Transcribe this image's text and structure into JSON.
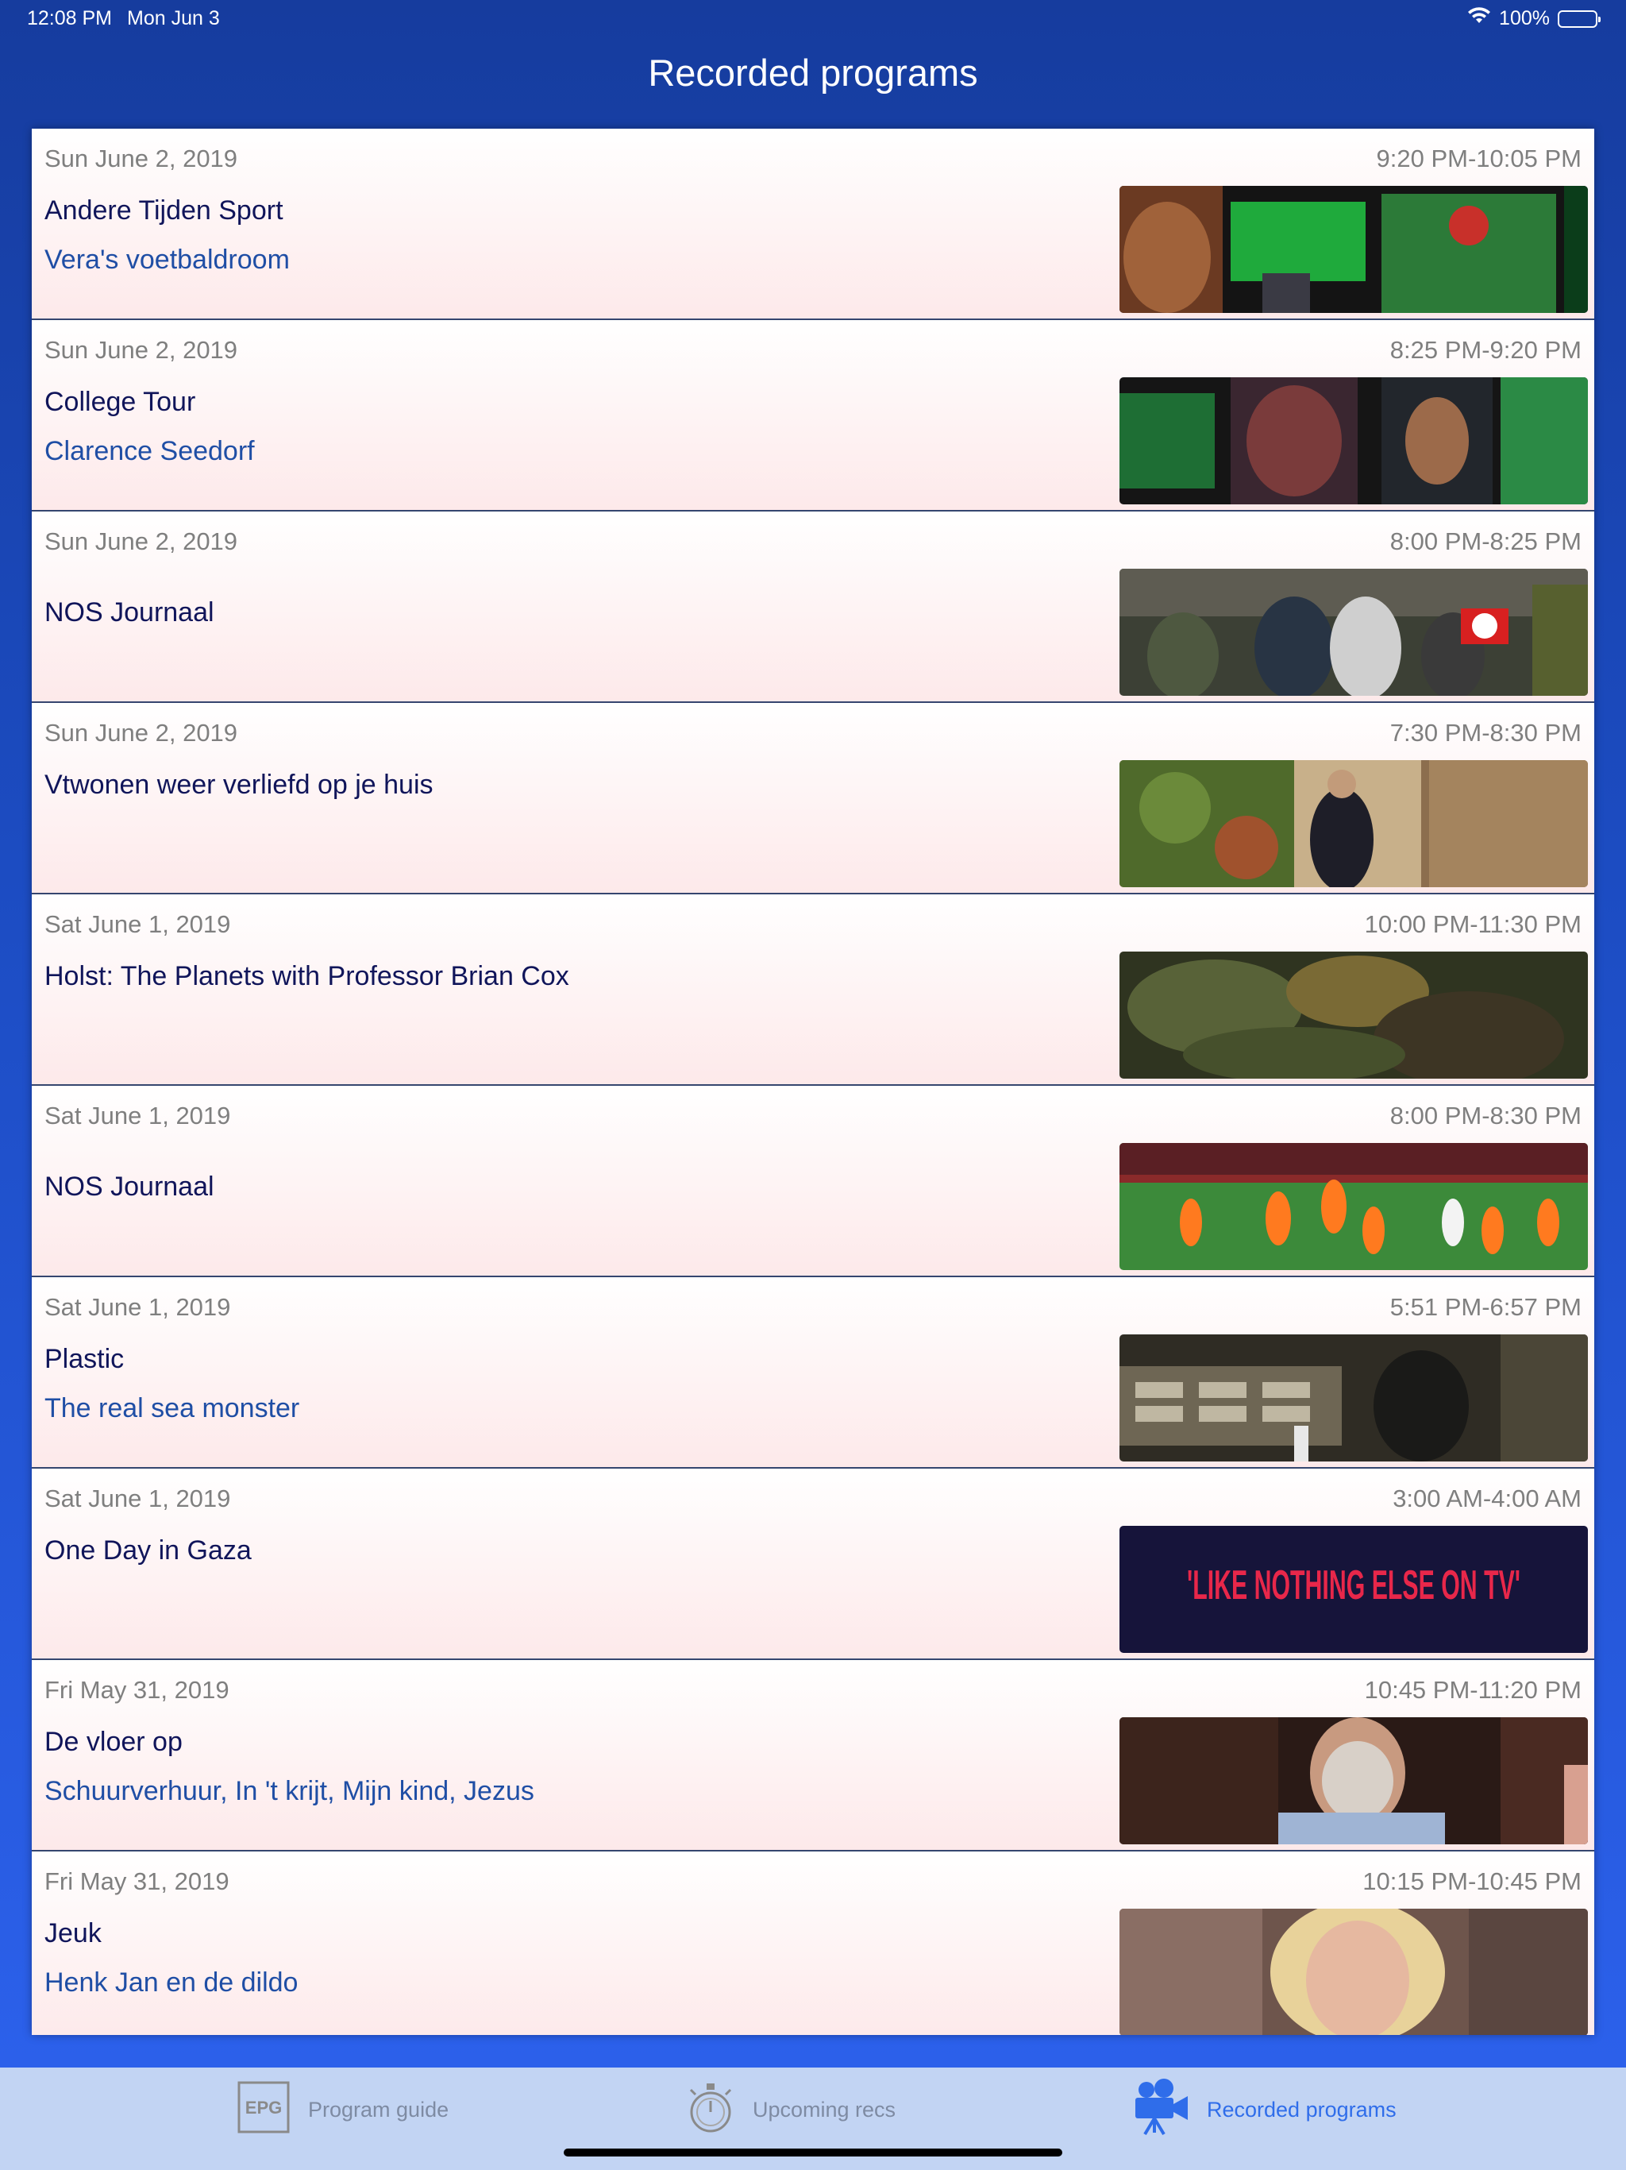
{
  "status_bar": {
    "time": "12:08 PM",
    "date": "Mon Jun 3",
    "battery": "100%",
    "wifi_icon": "wifi-icon"
  },
  "header": {
    "title": "Recorded programs"
  },
  "recordings": [
    {
      "date": "Sun June 2, 2019",
      "time": "9:20 PM-10:05 PM",
      "title": "Andere Tijden Sport",
      "subtitle": "Vera's voetbaldroom"
    },
    {
      "date": "Sun June 2, 2019",
      "time": "8:25 PM-9:20 PM",
      "title": "College Tour",
      "subtitle": "Clarence Seedorf"
    },
    {
      "date": "Sun June 2, 2019",
      "time": "8:00 PM-8:25 PM",
      "title": "NOS Journaal",
      "subtitle": ""
    },
    {
      "date": "Sun June 2, 2019",
      "time": "7:30 PM-8:30 PM",
      "title": "Vtwonen weer verliefd op je huis",
      "subtitle": ""
    },
    {
      "date": "Sat June 1, 2019",
      "time": "10:00 PM-11:30 PM",
      "title": "Holst: The Planets with Professor Brian Cox",
      "subtitle": ""
    },
    {
      "date": "Sat June 1, 2019",
      "time": "8:00 PM-8:30 PM",
      "title": "NOS Journaal",
      "subtitle": ""
    },
    {
      "date": "Sat June 1, 2019",
      "time": "5:51 PM-6:57 PM",
      "title": "Plastic",
      "subtitle": "The real sea monster"
    },
    {
      "date": "Sat June 1, 2019",
      "time": "3:00 AM-4:00 AM",
      "title": "One Day in Gaza",
      "subtitle": "",
      "thumb_text": "'LIKE NOTHING ELSE ON TV'"
    },
    {
      "date": "Fri May 31, 2019",
      "time": "10:45 PM-11:20 PM",
      "title": "De vloer op",
      "subtitle": "Schuurverhuur, In 't krijt, Mijn kind, Jezus"
    },
    {
      "date": "Fri May 31, 2019",
      "time": "10:15 PM-10:45 PM",
      "title": "Jeuk",
      "subtitle": "Henk Jan en de dildo"
    }
  ],
  "tab_bar": {
    "tabs": [
      {
        "label": "Program guide",
        "icon": "epg-icon",
        "icon_text": "EPG",
        "active": false
      },
      {
        "label": "Upcoming recs",
        "icon": "stopwatch-icon",
        "active": false
      },
      {
        "label": "Recorded programs",
        "icon": "video-camera-icon",
        "active": true
      }
    ]
  },
  "colors": {
    "accent": "#2f6dea",
    "title_text": "#10155a",
    "subtitle_text": "#1f4ea5",
    "meta_text": "#7f7f7f"
  }
}
